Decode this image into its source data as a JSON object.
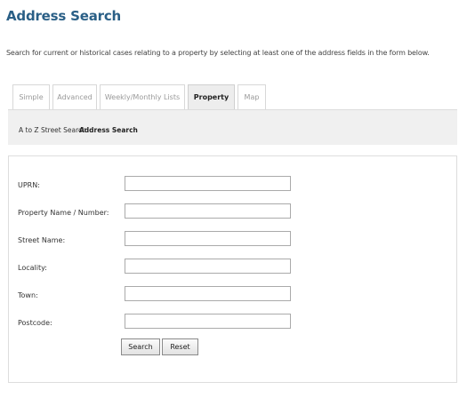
{
  "header": {
    "title": "Address Search",
    "intro": "Search for current or historical cases relating to a property by selecting at least one of the address fields in the form below."
  },
  "tabs": [
    {
      "label": "Simple",
      "active": false
    },
    {
      "label": "Advanced",
      "active": false
    },
    {
      "label": "Weekly/Monthly Lists",
      "active": false
    },
    {
      "label": "Property",
      "active": true
    },
    {
      "label": "Map",
      "active": false
    }
  ],
  "subnav": {
    "items": [
      {
        "label": "A to Z Street Search",
        "active": false
      },
      {
        "label": "Address Search",
        "active": true
      }
    ]
  },
  "form": {
    "fields": [
      {
        "label": "UPRN:",
        "value": ""
      },
      {
        "label": "Property Name / Number:",
        "value": ""
      },
      {
        "label": "Street Name:",
        "value": ""
      },
      {
        "label": "Locality:",
        "value": ""
      },
      {
        "label": "Town:",
        "value": ""
      },
      {
        "label": "Postcode:",
        "value": ""
      }
    ],
    "search_label": "Search",
    "reset_label": "Reset"
  }
}
